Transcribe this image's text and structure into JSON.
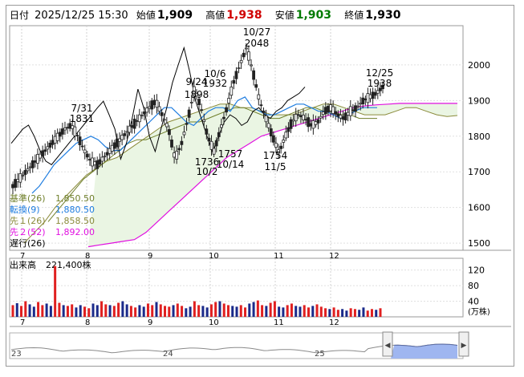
{
  "header": {
    "label_date": "日付",
    "date": "2025/12/25 15:30",
    "label_open": "始値",
    "open": "1,909",
    "label_high": "高値",
    "high": "1,938",
    "label_low": "安値",
    "low": "1,903",
    "label_close": "終値",
    "close": "1,930"
  },
  "colors": {
    "up": "#ffffff",
    "down": "#222222",
    "kijun": "#6f7f2a",
    "tenkan": "#1f7de0",
    "senkou1": "#8a8a3a",
    "senkou2": "#e010e0",
    "chikou": "#000000",
    "cloud": "#eaf5e3",
    "vol_up": "#e02020",
    "vol_down": "#1a2a8a",
    "mini_fill": "#9fb6f0"
  },
  "legend": [
    {
      "label": "基準(26)",
      "value": "1,850.50",
      "color": "#6f7f2a"
    },
    {
      "label": "転換(9)",
      "value": "1,880.50",
      "color": "#1f7de0"
    },
    {
      "label": "先１(26)",
      "value": "1,858.50",
      "color": "#8a8a3a"
    },
    {
      "label": "先２(52)",
      "value": "1,892.00",
      "color": "#e010e0"
    },
    {
      "label": "遅行(26)",
      "value": "",
      "color": "#000000"
    }
  ],
  "volume_label": "出来高",
  "volume_value": "221,400株",
  "volume_unit": "(万株)",
  "mini_labels": [
    "23",
    "24",
    "25"
  ],
  "chart_data": {
    "type": "candlestick",
    "price_axis": {
      "ticks": [
        1500,
        1600,
        1700,
        1800,
        1900,
        2000
      ],
      "range": [
        1480,
        2110
      ]
    },
    "volume_axis": {
      "ticks": [
        40,
        80,
        120
      ],
      "range": [
        0,
        150
      ],
      "unit": "万株"
    },
    "x_month_labels": [
      "7",
      "8",
      "9",
      "10",
      "11",
      "12"
    ],
    "annotations": [
      {
        "text": "7/31",
        "value": "1831"
      },
      {
        "text": "9/24",
        "value": "1898"
      },
      {
        "text": "10/6",
        "value": "1932"
      },
      {
        "text": "10/27",
        "value": "2048"
      },
      {
        "text": "12/25",
        "value": "1938"
      },
      {
        "text": "10/2",
        "value": "1736"
      },
      {
        "text": "10/14",
        "value": "1757"
      },
      {
        "text": "11/5",
        "value": "1754"
      }
    ],
    "price_polyline_estimate": [
      1660,
      1680,
      1700,
      1720,
      1740,
      1760,
      1780,
      1800,
      1820,
      1831,
      1800,
      1760,
      1730,
      1720,
      1740,
      1760,
      1780,
      1800,
      1820,
      1840,
      1860,
      1880,
      1898,
      1860,
      1820,
      1736,
      1780,
      1850,
      1932,
      1880,
      1800,
      1757,
      1820,
      1880,
      1950,
      2000,
      2048,
      1980,
      1900,
      1850,
      1800,
      1754,
      1800,
      1840,
      1860,
      1850,
      1830,
      1840,
      1870,
      1880,
      1860,
      1850,
      1870,
      1880,
      1900,
      1910,
      1920,
      1938
    ],
    "tenkan_estimate": [
      1640,
      1660,
      1690,
      1720,
      1740,
      1760,
      1780,
      1790,
      1800,
      1790,
      1770,
      1760,
      1760,
      1780,
      1800,
      1820,
      1840,
      1860,
      1880,
      1880,
      1860,
      1840,
      1830,
      1850,
      1870,
      1880,
      1880,
      1870,
      1900,
      1910,
      1880,
      1870,
      1860,
      1860,
      1870,
      1880,
      1890,
      1890,
      1880,
      1870,
      1870,
      1860,
      1850,
      1860,
      1870,
      1880,
      1880,
      1880
    ],
    "kijun_estimate": [
      1560,
      1590,
      1620,
      1650,
      1680,
      1700,
      1720,
      1740,
      1760,
      1780,
      1790,
      1790,
      1800,
      1810,
      1820,
      1830,
      1840,
      1840,
      1850,
      1860,
      1870,
      1880,
      1880,
      1870,
      1860,
      1850,
      1850,
      1860,
      1870,
      1880,
      1880,
      1870,
      1870,
      1860,
      1860,
      1850,
      1850,
      1850
    ],
    "senkou1_estimate": [
      1500,
      1530,
      1560,
      1600,
      1630,
      1660,
      1690,
      1710,
      1730,
      1740,
      1760,
      1780,
      1800,
      1820,
      1840,
      1850,
      1860,
      1870,
      1880,
      1890,
      1890,
      1880,
      1880,
      1870,
      1860,
      1860,
      1860,
      1870,
      1880,
      1890,
      1890,
      1880,
      1870,
      1860,
      1860,
      1860,
      1870,
      1880,
      1880,
      1870,
      1860,
      1855,
      1858
    ],
    "senkou2_estimate": [
      1490,
      1495,
      1500,
      1505,
      1510,
      1530,
      1560,
      1590,
      1620,
      1650,
      1680,
      1710,
      1740,
      1760,
      1780,
      1800,
      1810,
      1820,
      1830,
      1840,
      1850,
      1860,
      1870,
      1880,
      1885,
      1888,
      1890,
      1892,
      1892,
      1892,
      1892,
      1892,
      1892
    ],
    "volume_estimate": [
      30,
      35,
      28,
      40,
      32,
      26,
      38,
      30,
      34,
      28,
      130,
      36,
      30,
      28,
      32,
      24,
      30,
      26,
      22,
      34,
      30,
      40,
      32,
      30,
      28,
      36,
      40,
      32,
      28,
      24,
      30,
      26,
      34,
      30,
      38,
      32,
      28,
      26,
      30,
      34,
      28,
      22,
      26,
      40,
      30,
      28,
      24,
      32,
      38,
      40,
      34,
      30,
      28,
      26,
      30,
      24,
      34,
      38,
      42,
      30,
      28,
      36,
      40,
      26,
      24,
      30,
      34,
      28,
      26,
      30,
      24,
      28,
      32,
      26,
      22,
      20,
      24,
      18,
      20,
      16,
      22,
      20,
      18,
      24,
      16,
      20,
      18,
      22
    ]
  }
}
